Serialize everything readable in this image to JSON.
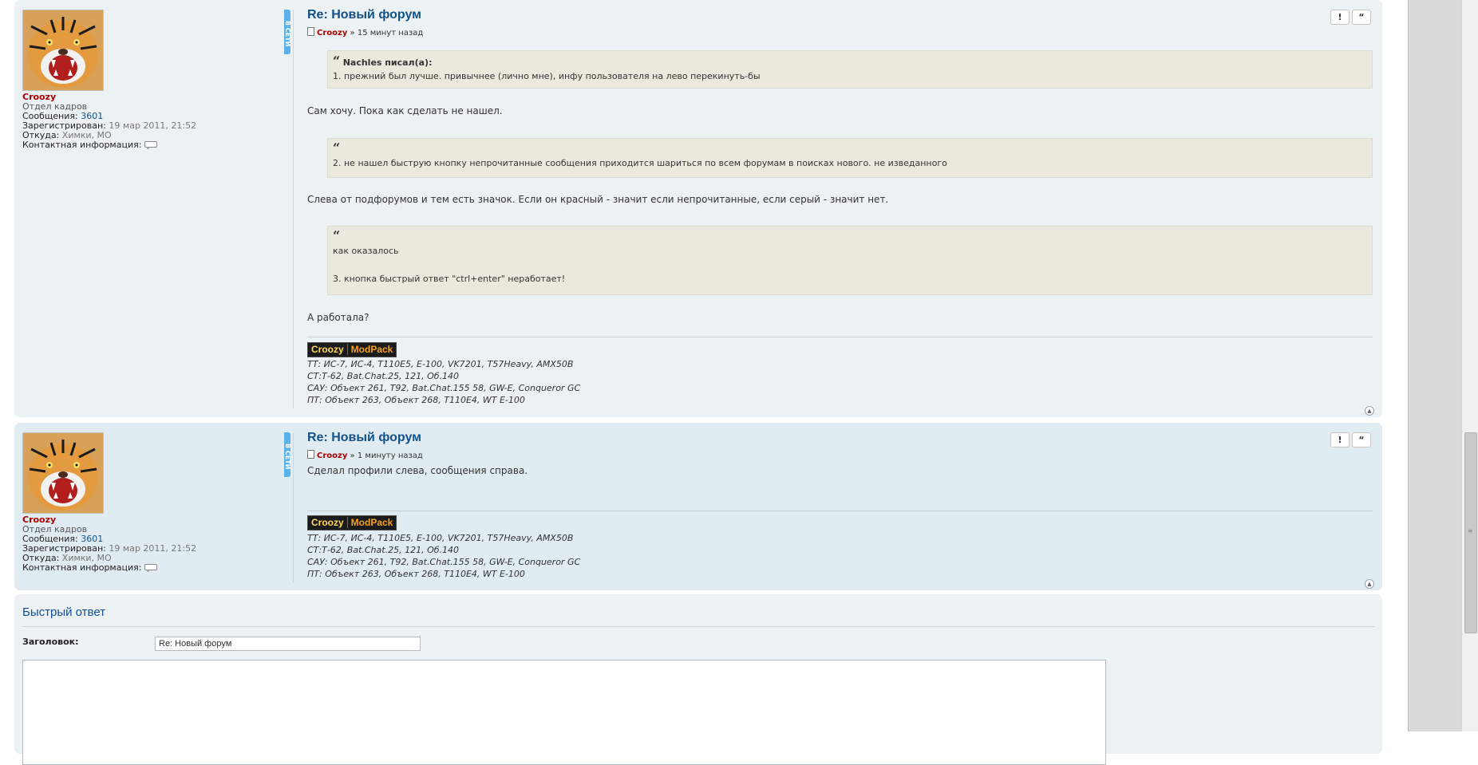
{
  "posts": [
    {
      "title": "Re: Новый форум",
      "author": "Croozy",
      "time": "15 минут назад",
      "online": "В СЕТИ",
      "profile": {
        "name": "Croozy",
        "rank": "Отдел кадров",
        "messages_label": "Сообщения:",
        "messages": "3601",
        "registered_label": "Зарегистрирован:",
        "registered": "19 мар 2011, 21:52",
        "from_label": "Откуда:",
        "from": "Химки, МО",
        "contact_label": "Контактная информация:"
      },
      "buttons": {
        "report": "!",
        "quote": "“"
      },
      "content": {
        "quote1_cite": "Nachles писал(а):",
        "quote1_text": "1. прежний был лучше. привычнее (лично мне), инфу пользователя на лево перекинуть-бы",
        "reply1": "Сам хочу. Пока как сделать не нашел.",
        "quote2_text": "2. не нашел быструю кнопку непрочитанные сообщения приходится шариться по всем форумам в поисках нового. не изведанного",
        "reply2": "Слева от подфорумов и тем есть значок. Если он красный - значит если непрочитанные, если серый - значит нет.",
        "quote3_line1": "как оказалось",
        "quote3_line2": "3. кнопка быстрый ответ \"ctrl+enter\" неработает!",
        "reply3": "А работала?"
      }
    },
    {
      "title": "Re: Новый форум",
      "author": "Croozy",
      "time": "1 минуту назад",
      "online": "В СЕТИ",
      "profile": {
        "name": "Croozy",
        "rank": "Отдел кадров",
        "messages_label": "Сообщения:",
        "messages": "3601",
        "registered_label": "Зарегистрирован:",
        "registered": "19 мар 2011, 21:52",
        "from_label": "Откуда:",
        "from": "Химки, МО",
        "contact_label": "Контактная информация:"
      },
      "buttons": {
        "report": "!",
        "quote": "“"
      },
      "content": {
        "text": "Сделал профили слева, сообщения справа."
      }
    }
  ],
  "signature": {
    "badge_part1": "Croozy",
    "badge_part2": "ModPack",
    "lines": [
      "ТТ: ИС-7, ИС-4, T110E5, E-100, VK7201, T57Heavy, AMX50B",
      "СТ:Т-62, Bat.Chat.25, 121, Об.140",
      "САУ: Объект 261, T92, Bat.Chat.155 58, GW-E, Conqueror GC",
      "ПТ: Объект 263, Объект 268, T110E4, WT E-100"
    ]
  },
  "quick_reply": {
    "title": "Быстрый ответ",
    "subject_label": "Заголовок:",
    "subject_value": "Re: Новый форум"
  },
  "meta": {
    "separator": "»",
    "quote_mark": "“"
  }
}
